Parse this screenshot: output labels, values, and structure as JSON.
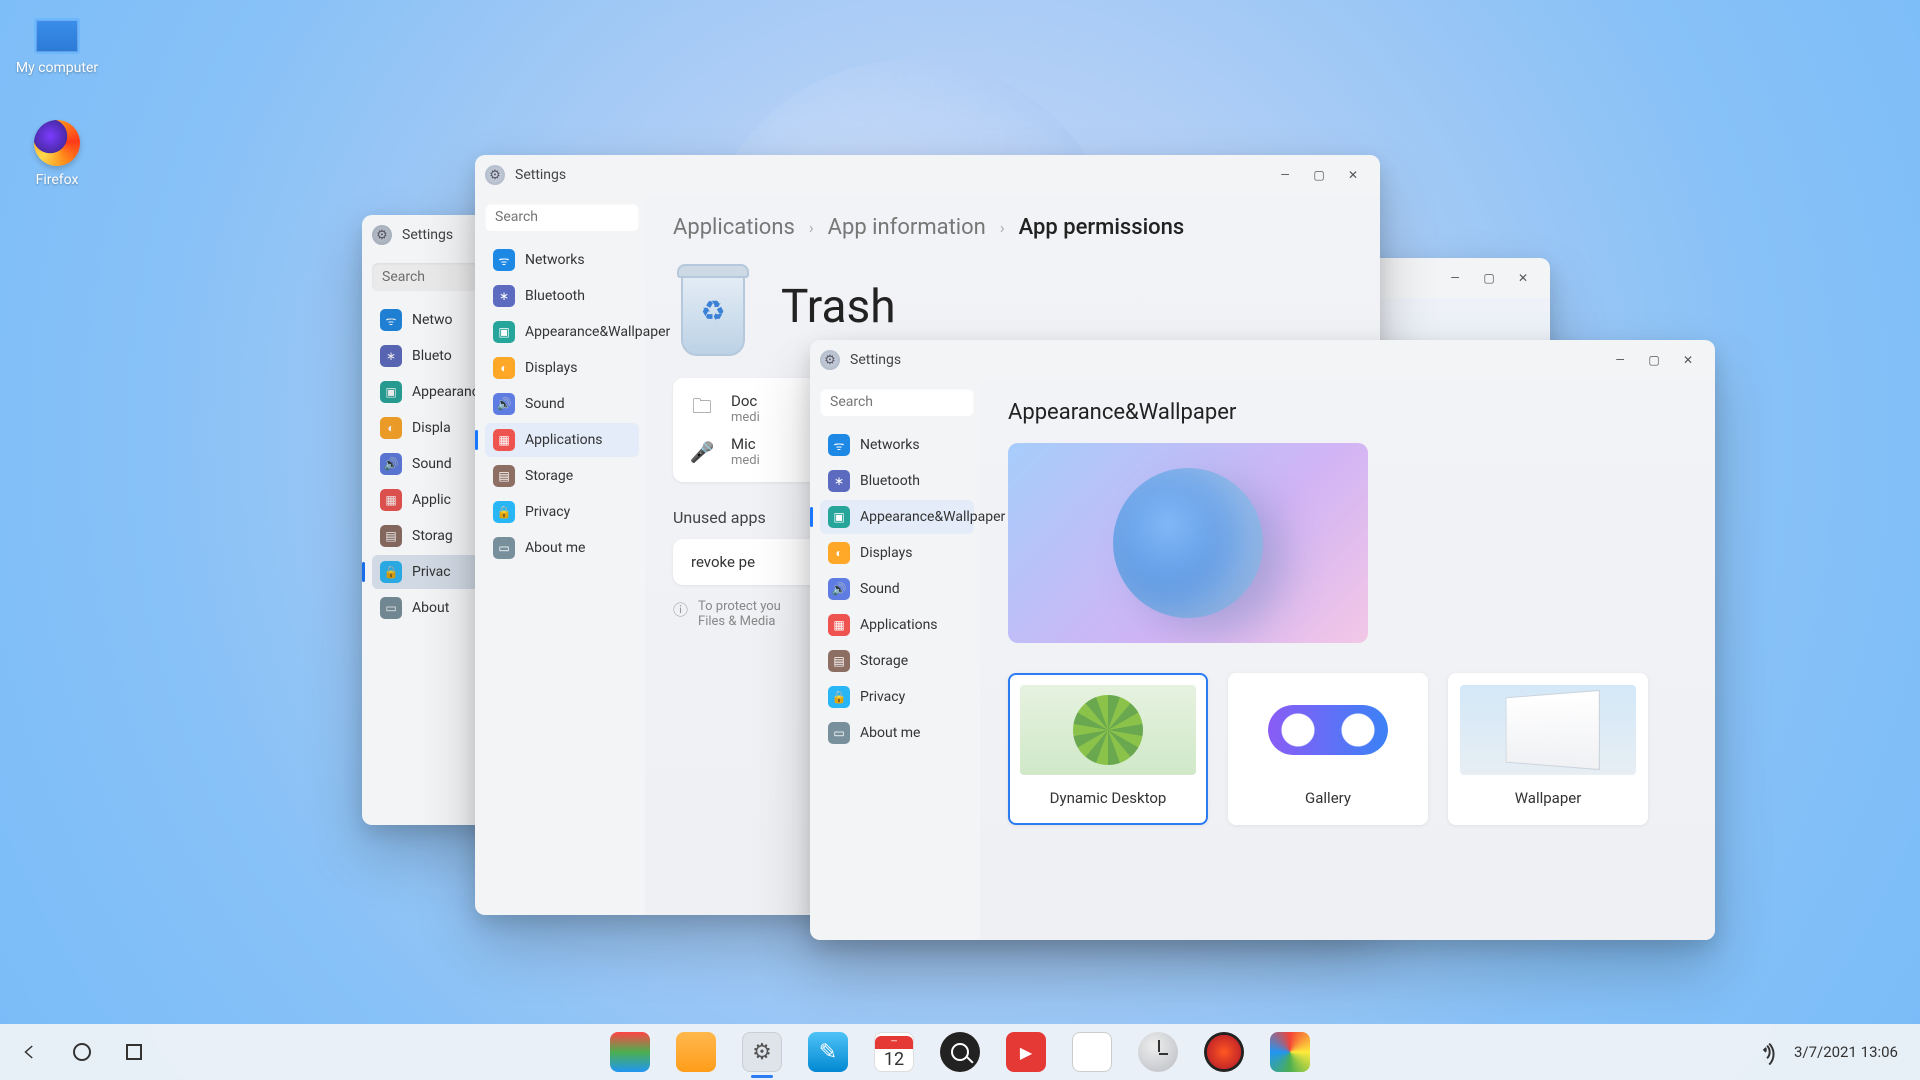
{
  "desktop": {
    "my_computer": "My computer",
    "firefox": "Firefox"
  },
  "sidebar_items": {
    "networks": "Networks",
    "bluetooth": "Bluetooth",
    "appearance": "Appearance&Wallpaper",
    "displays": "Displays",
    "sound": "Sound",
    "applications": "Applications",
    "storage": "Storage",
    "privacy": "Privacy",
    "about": "About me"
  },
  "search_placeholder": "Search",
  "win_back": {
    "title": "Settings",
    "active": "privacy",
    "visible_items": {
      "networks": "Netwo",
      "bluetooth": "Blueto",
      "appearance": "Appearance&allpaper",
      "displays": "Displa",
      "sound": "Sound",
      "applications": "Applic",
      "storage": "Storag",
      "privacy": "Privac",
      "about": "About"
    }
  },
  "win_mid": {
    "title": "Settings",
    "active": "applications",
    "breadcrumb": [
      "Applications",
      "App information",
      "App permissions"
    ],
    "app_title": "Trash",
    "permissions": [
      {
        "icon": "🗀",
        "label": "Doc",
        "sub": "medi"
      },
      {
        "icon": "🎤",
        "label": "Mic",
        "sub": "medi"
      }
    ],
    "unused_heading": "Unused apps",
    "revoke_label": "revoke pe",
    "footnote": "To protect you\nFiles & Media",
    "footnote_lines": [
      "To protect you",
      "Files & Media"
    ]
  },
  "win_front": {
    "title": "Settings",
    "active": "appearance",
    "page_title": "Appearance&Wallpaper",
    "cards": [
      "Dynamic Desktop",
      "Gallery",
      "Wallpaper"
    ],
    "selected_card": 0
  },
  "taskbar": {
    "calendar_day": "12",
    "datetime": "3/7/2021 13:06"
  }
}
